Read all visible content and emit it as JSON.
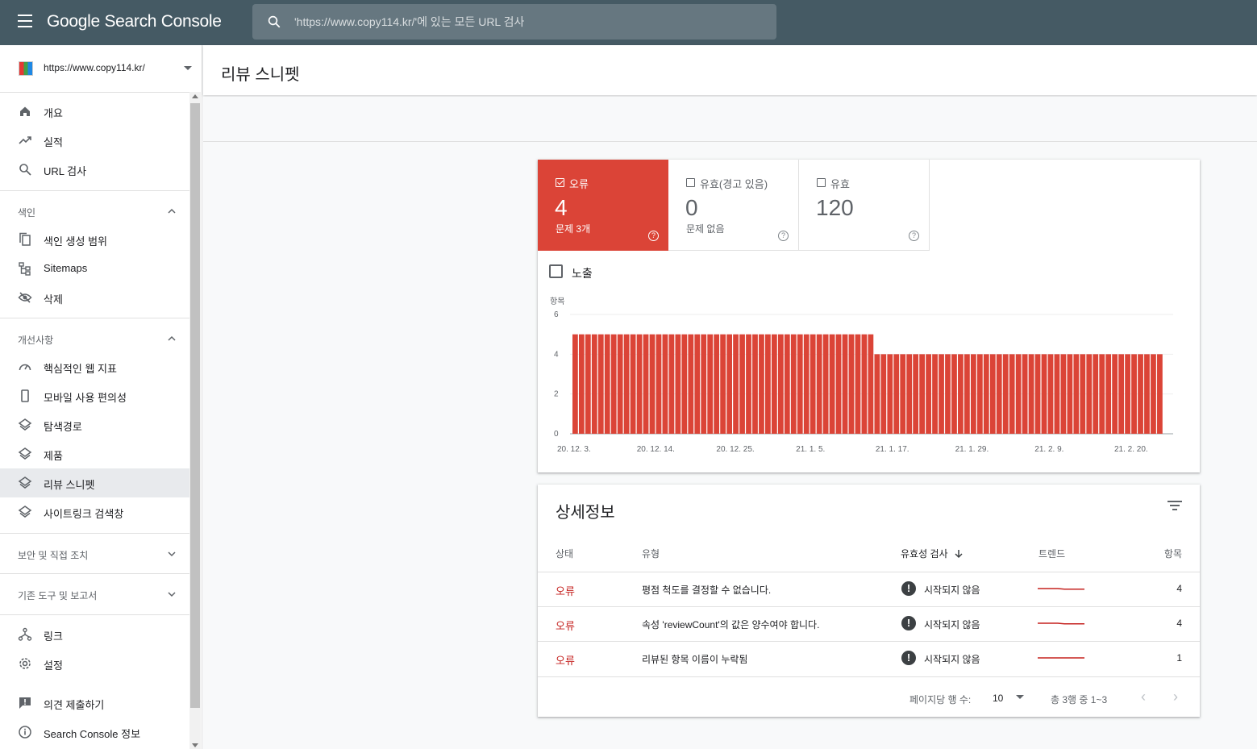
{
  "app": {
    "brand": "Google Search Console",
    "search_placeholder": "'https://www.copy114.kr/'에 있는 모든 URL 검사"
  },
  "property": {
    "url": "https://www.copy114.kr/"
  },
  "sidebar": {
    "top_items": [
      {
        "label": "개요",
        "icon": "home-icon"
      },
      {
        "label": "실적",
        "icon": "trending-up-icon"
      },
      {
        "label": "URL 검사",
        "icon": "search-icon"
      }
    ],
    "index_section": "색인",
    "index_items": [
      {
        "label": "색인 생성 범위",
        "icon": "file-copy-icon"
      },
      {
        "label": "Sitemaps",
        "icon": "sitemap-icon"
      },
      {
        "label": "삭제",
        "icon": "eye-off-icon"
      }
    ],
    "enhancements_section": "개선사항",
    "enhancement_items": [
      {
        "label": "핵심적인 웹 지표",
        "icon": "gauge-icon"
      },
      {
        "label": "모바일 사용 편의성",
        "icon": "phone-icon"
      },
      {
        "label": "탐색경로",
        "icon": "layers-icon"
      },
      {
        "label": "제품",
        "icon": "layers-icon"
      },
      {
        "label": "리뷰 스니펫",
        "icon": "layers-icon",
        "active": true
      },
      {
        "label": "사이트링크 검색창",
        "icon": "layers-icon"
      }
    ],
    "security_section": "보안 및 직접 조치",
    "legacy_section": "기존 도구 및 보고서",
    "bottom_items": [
      {
        "label": "링크",
        "icon": "links-icon"
      },
      {
        "label": "설정",
        "icon": "gear-icon"
      }
    ],
    "footer_items": [
      {
        "label": "의견 제출하기",
        "icon": "feedback-icon"
      },
      {
        "label": "Search Console 정보",
        "icon": "info-icon"
      }
    ]
  },
  "page": {
    "title": "리뷰 스니펫"
  },
  "summary": {
    "error": {
      "label": "오류",
      "value": "4",
      "sub": "문제 3개",
      "checked": true
    },
    "warning": {
      "label": "유효(경고 있음)",
      "value": "0",
      "sub": "문제 없음",
      "checked": false
    },
    "valid": {
      "label": "유효",
      "value": "120",
      "sub": "",
      "checked": false
    },
    "impressions_label": "노출"
  },
  "chart_data": {
    "type": "bar",
    "ylabel": "항목",
    "ylim": [
      0,
      6
    ],
    "yticks": [
      "0",
      "2",
      "4",
      "6"
    ],
    "xticks": [
      "20. 12. 3.",
      "20. 12. 14.",
      "20. 12. 25.",
      "21. 1. 5.",
      "21. 1. 17.",
      "21. 1. 29.",
      "21. 2. 9.",
      "21. 2. 20."
    ],
    "color": "#db4437",
    "values": [
      5,
      5,
      5,
      5,
      5,
      5,
      5,
      5,
      5,
      5,
      5,
      5,
      5,
      5,
      5,
      5,
      5,
      5,
      5,
      5,
      5,
      5,
      5,
      5,
      5,
      5,
      5,
      5,
      5,
      5,
      5,
      5,
      5,
      5,
      5,
      5,
      5,
      5,
      5,
      5,
      5,
      5,
      5,
      5,
      5,
      5,
      5,
      4,
      4,
      4,
      4,
      4,
      4,
      4,
      4,
      4,
      4,
      4,
      4,
      4,
      4,
      4,
      4,
      4,
      4,
      4,
      4,
      4,
      4,
      4,
      4,
      4,
      4,
      4,
      4,
      4,
      4,
      4,
      4,
      4,
      4,
      4,
      4,
      4,
      4,
      4,
      4,
      4,
      4,
      4,
      4,
      4
    ]
  },
  "details": {
    "title": "상세정보",
    "headers": {
      "status": "상태",
      "type": "유형",
      "validation": "유효성 검사",
      "trend": "트렌드",
      "count": "항목"
    },
    "rows": [
      {
        "status": "오류",
        "type": "평점 척도를 결정할 수 없습니다.",
        "validation": "시작되지 않음",
        "count": "4",
        "trend": [
          5,
          5,
          5,
          5,
          4,
          4,
          4,
          4
        ]
      },
      {
        "status": "오류",
        "type": "속성 'reviewCount'의 값은 양수여야 합니다.",
        "validation": "시작되지 않음",
        "count": "4",
        "trend": [
          5,
          5,
          5,
          5,
          4,
          4,
          4,
          4
        ]
      },
      {
        "status": "오류",
        "type": "리뷰된 항목 이름이 누락됨",
        "validation": "시작되지 않음",
        "count": "1",
        "trend": [
          1,
          1,
          1,
          1,
          1,
          1,
          1,
          1
        ]
      }
    ],
    "pager": {
      "rows_per_page_label": "페이지당 행 수:",
      "rows_per_page": "10",
      "range": "총 3행 중 1~3"
    }
  }
}
